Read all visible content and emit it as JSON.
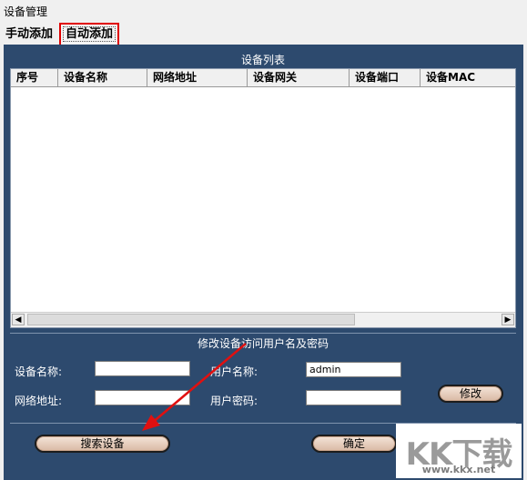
{
  "window": {
    "title": "设备管理"
  },
  "tabs": [
    {
      "label": "手动添加"
    },
    {
      "label": "自动添加"
    }
  ],
  "device_list": {
    "title": "设备列表",
    "columns": [
      "序号",
      "设备名称",
      "网络地址",
      "设备网关",
      "设备端口",
      "设备MAC"
    ],
    "rows": []
  },
  "edit_section": {
    "title": "修改设备访问用户名及密码",
    "device_name_label": "设备名称:",
    "device_name_value": "",
    "network_address_label": "网络地址:",
    "network_address_value": "",
    "username_label": "用户名称:",
    "username_value": "admin",
    "password_label": "用户密码:",
    "password_value": "",
    "modify_button": "修改"
  },
  "footer": {
    "search_button": "搜索设备",
    "confirm_button": "确定"
  },
  "watermark": {
    "logo_text": "KK下载",
    "url": "www.kkx.net"
  },
  "colors": {
    "panel": "#2d4a6e",
    "highlight_box": "#e00000",
    "arrow": "#e01010",
    "button_fill": "#e6c8b4"
  }
}
